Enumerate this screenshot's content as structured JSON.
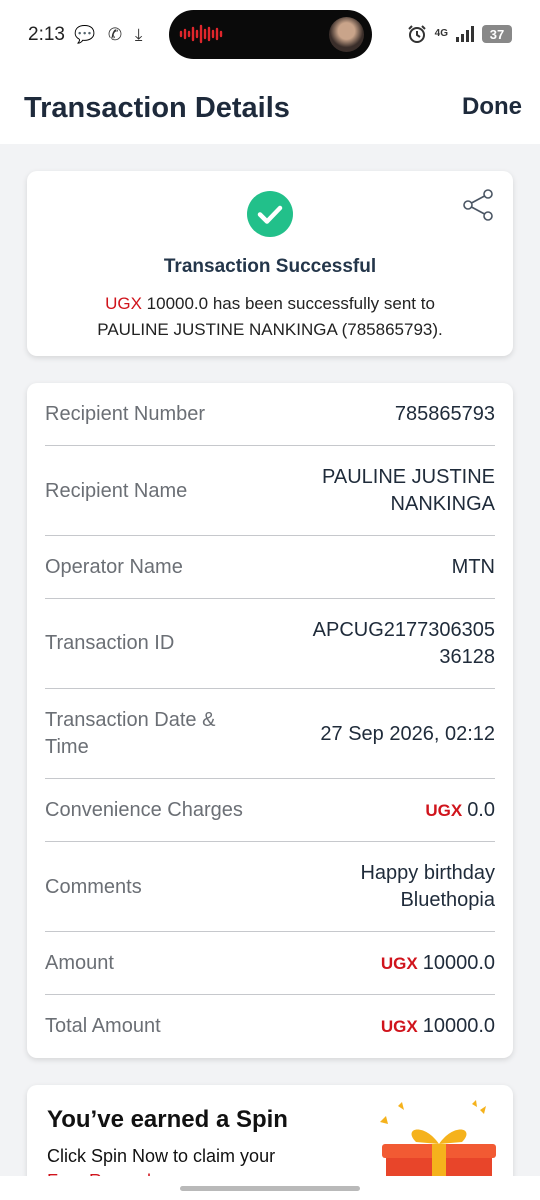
{
  "status_bar": {
    "time": "2:13",
    "left_icons": "💬 ✆ ⤓",
    "network": "4G",
    "battery": "37"
  },
  "header": {
    "title": "Transaction Details",
    "done_label": "Done"
  },
  "success": {
    "title": "Transaction Successful",
    "currency": "UGX",
    "message_amount": "10000.0",
    "message_rest": " has been successfully sent to",
    "message_line2": "PAULINE JUSTINE NANKINGA (785865793).",
    "icon": "check-circle-icon",
    "accent": "#22c08a"
  },
  "details": [
    {
      "label": "Recipient Number",
      "value": "785865793"
    },
    {
      "label": "Recipient Name",
      "value": "PAULINE JUSTINE",
      "value2": "NANKINGA"
    },
    {
      "label": "Operator Name",
      "value": "MTN"
    },
    {
      "label": "Transaction ID",
      "value": "APCUG2177306305",
      "value2": "36128"
    },
    {
      "label": "Transaction Date &",
      "label2": "Time",
      "value": "27 Sep 2026, 02:12"
    },
    {
      "label": "Convenience Charges",
      "currency": "UGX",
      "value": "0.0"
    },
    {
      "label": "Comments",
      "value": "Happy birthday",
      "value2": "Bluethopia "
    },
    {
      "label": "Amount",
      "currency": "UGX",
      "value": "10000.0"
    },
    {
      "label": "Total Amount",
      "currency": "UGX",
      "value": "10000.0"
    }
  ],
  "spin": {
    "title": "You’ve earned a Spin",
    "text": "Click Spin Now to claim your",
    "link": "Free Reward"
  }
}
